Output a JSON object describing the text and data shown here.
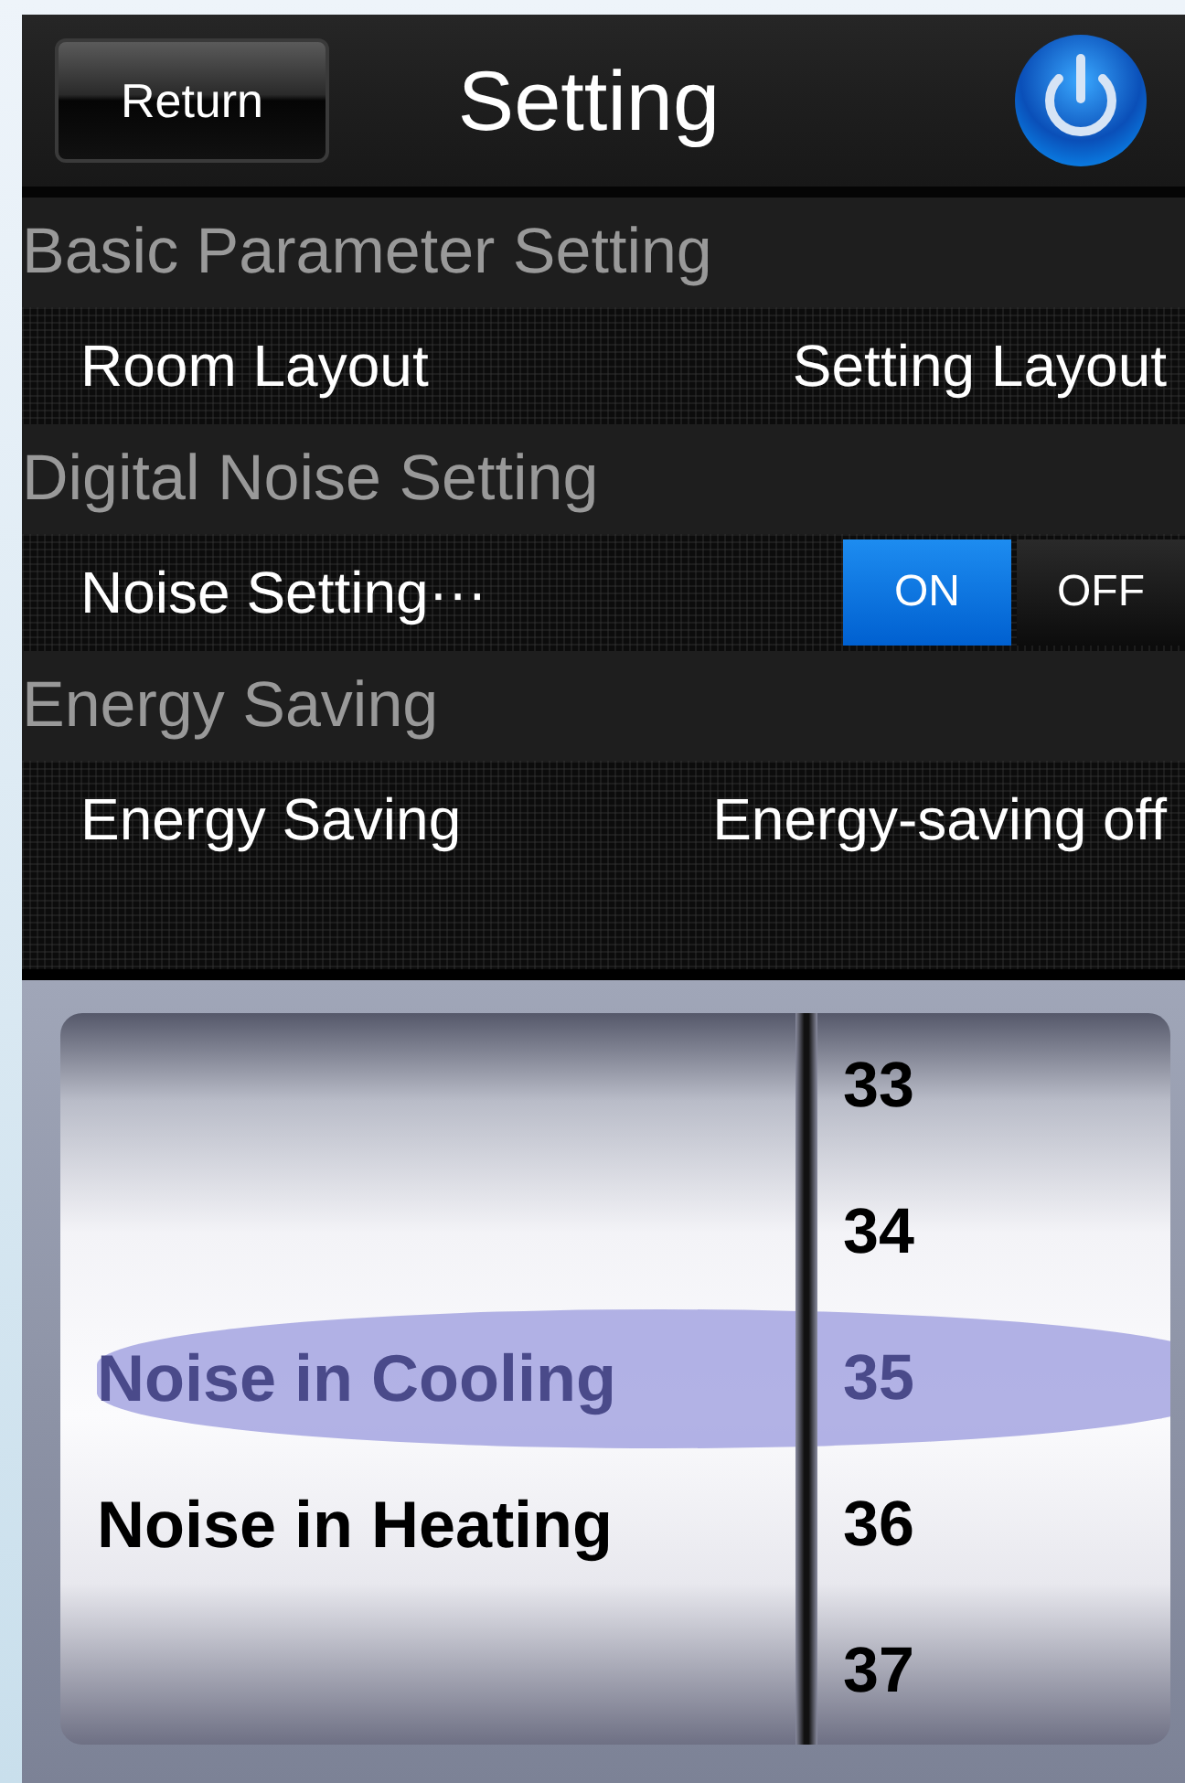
{
  "header": {
    "back_button": "Return",
    "title": "Setting"
  },
  "sections": [
    {
      "heading": "Basic Parameter Setting",
      "row": {
        "kind": "value",
        "label": "Room Layout",
        "value": "Setting Layout"
      }
    },
    {
      "heading": "Digital Noise Setting",
      "row": {
        "kind": "toggle",
        "label": "Noise Setting···",
        "options": [
          {
            "label": "ON",
            "selected": true
          },
          {
            "label": "OFF",
            "selected": false
          }
        ]
      }
    },
    {
      "heading": "Energy Saving",
      "row": {
        "kind": "value",
        "label": "Energy Saving",
        "value": "Energy-saving off"
      }
    }
  ],
  "picker": {
    "left": [
      {
        "label": "Noise in Cooling",
        "selected": true
      },
      {
        "label": "Noise in Heating",
        "selected": false
      }
    ],
    "right": [
      {
        "label": "33",
        "selected": false
      },
      {
        "label": "34",
        "selected": false
      },
      {
        "label": "35",
        "selected": true
      },
      {
        "label": "36",
        "selected": false
      },
      {
        "label": "37",
        "selected": false
      }
    ]
  }
}
